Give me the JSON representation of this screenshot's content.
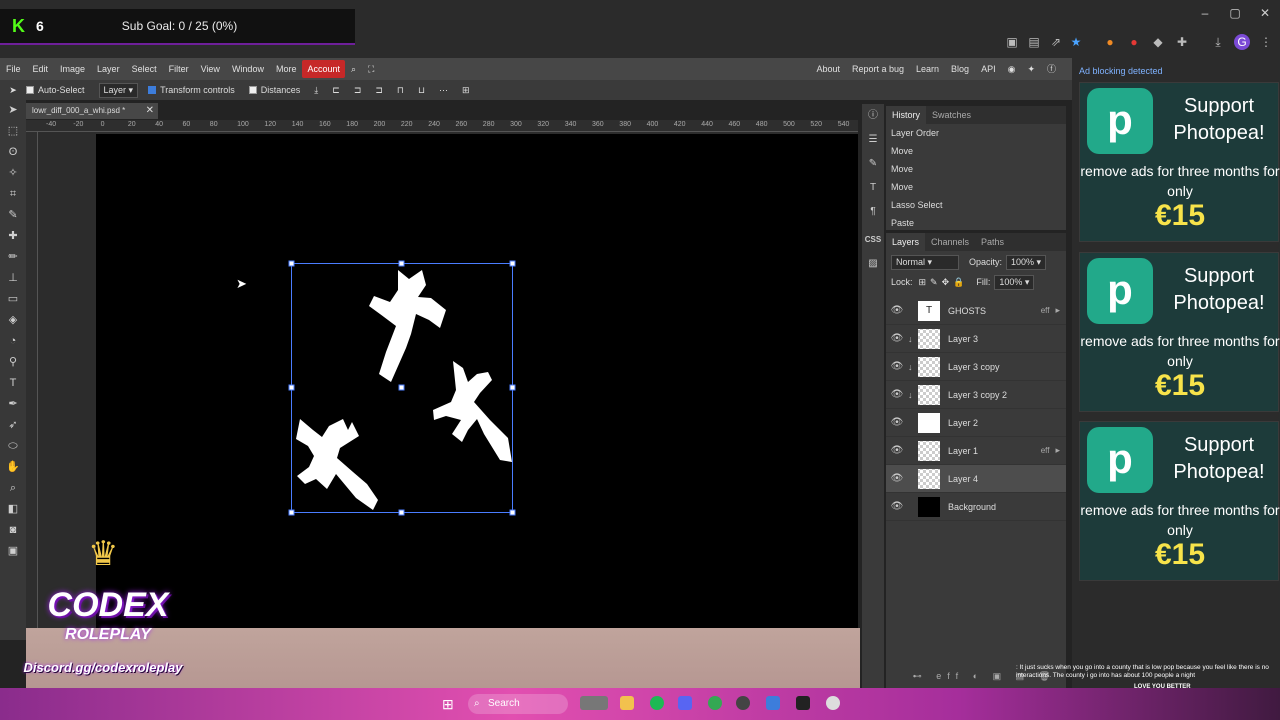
{
  "stream": {
    "kick_count": "6",
    "sub_goal": "Sub Goal: 0 / 25 (0%)"
  },
  "menu": {
    "items": [
      "File",
      "Edit",
      "Image",
      "Layer",
      "Select",
      "Filter",
      "View",
      "Window",
      "More",
      "Account"
    ],
    "right": [
      "About",
      "Report a bug",
      "Learn",
      "Blog",
      "API"
    ]
  },
  "options": {
    "auto_select": "Auto-Select",
    "layer_select": "Layer",
    "transform_controls": "Transform controls",
    "distances": "Distances"
  },
  "document": {
    "tab_name": "lowr_diff_000_a_whi.psd *"
  },
  "ruler": {
    "labels": [
      "-40",
      "-20",
      "0",
      "20",
      "40",
      "60",
      "80",
      "100",
      "120",
      "140",
      "160",
      "180",
      "200",
      "220",
      "240",
      "260",
      "280",
      "300",
      "320",
      "340",
      "360",
      "380",
      "400",
      "420",
      "440",
      "460",
      "480",
      "500",
      "520",
      "540"
    ]
  },
  "history": {
    "tabs": [
      "History",
      "Swatches"
    ],
    "items": [
      "Layer Order",
      "Move",
      "Move",
      "Move",
      "Lasso Select",
      "Paste"
    ]
  },
  "layers": {
    "tabs": [
      "Layers",
      "Channels",
      "Paths"
    ],
    "blend_mode": "Normal",
    "opacity_label": "Opacity:",
    "opacity": "100%",
    "lock_label": "Lock:",
    "fill_label": "Fill:",
    "fill": "100%",
    "items": [
      {
        "name": "GHOSTS",
        "eff": "eff"
      },
      {
        "name": "Layer 3",
        "eff": ""
      },
      {
        "name": "Layer 3 copy",
        "eff": ""
      },
      {
        "name": "Layer 3 copy 2",
        "eff": ""
      },
      {
        "name": "Layer 2",
        "eff": ""
      },
      {
        "name": "Layer 1",
        "eff": "eff"
      },
      {
        "name": "Layer 4",
        "eff": ""
      },
      {
        "name": "Background",
        "eff": ""
      }
    ],
    "side_label_css": "CSS"
  },
  "ads": {
    "blocked_text": "Ad blocking detected",
    "title": "Support Photopea!",
    "text": "remove ads for three months for only",
    "price": "€15",
    "accent": "#f7e34a"
  },
  "overlay": {
    "codex": "CODEX",
    "roleplay": "ROLEPLAY",
    "discord": "Discord.gg/codexroleplay"
  },
  "taskbar": {
    "search": "Search"
  },
  "chat": {
    "message": ": It just sucks when you go into a county that is low pop because you feel like there is no interactions. The county i go into has about 100 people a night",
    "now_playing": "LOVE YOU BETTER"
  }
}
